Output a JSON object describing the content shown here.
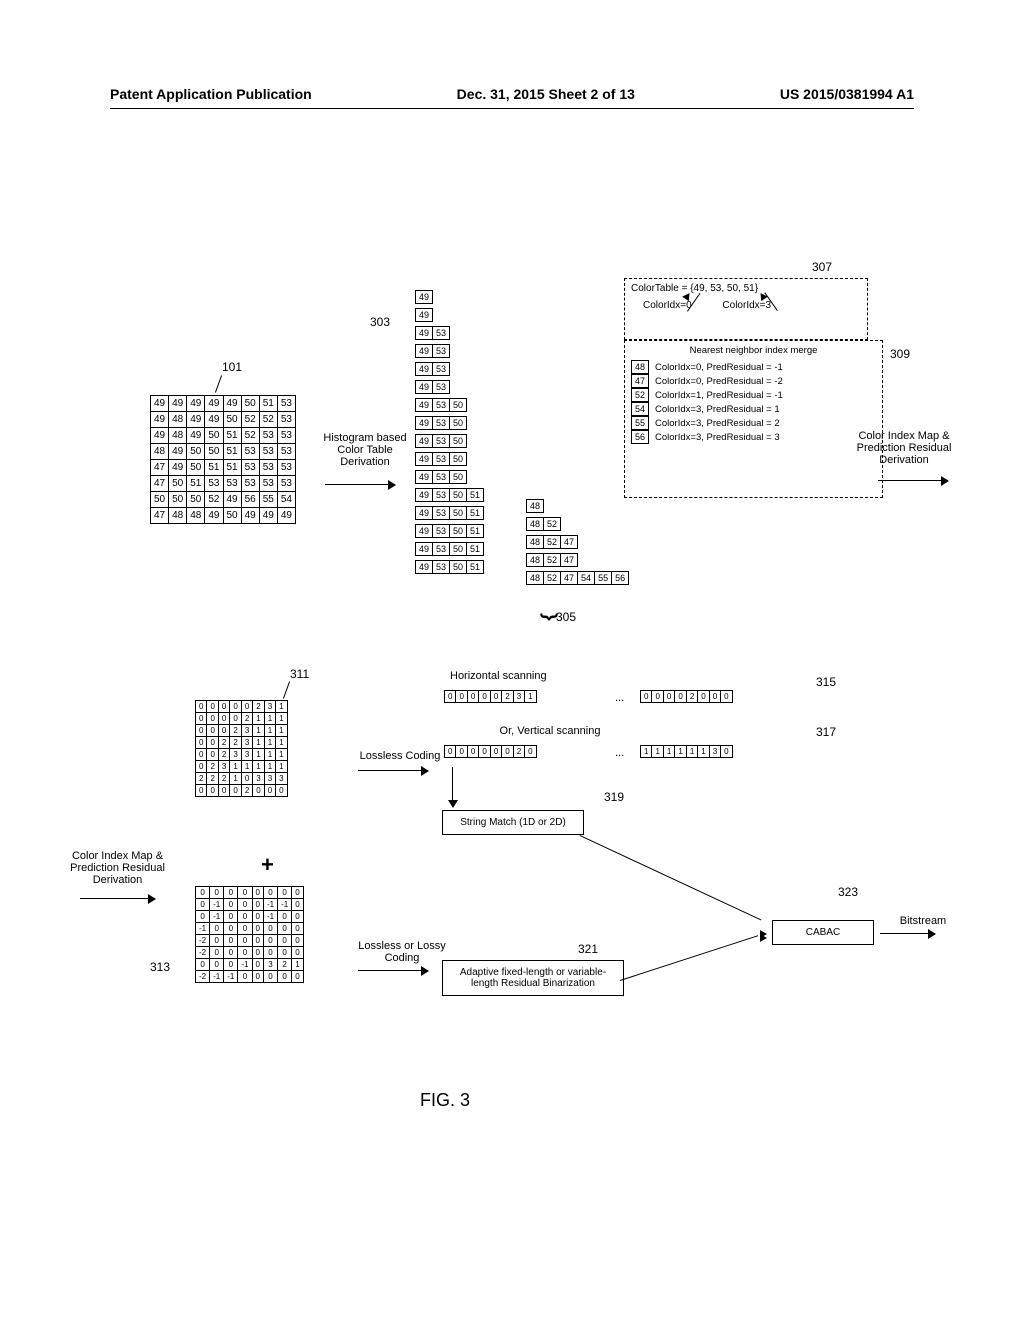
{
  "header": {
    "left": "Patent Application Publication",
    "mid": "Dec. 31, 2015  Sheet 2 of 13",
    "right": "US 2015/0381994 A1"
  },
  "callouts": {
    "c101": "101",
    "c303": "303",
    "c305": "305",
    "c307": "307",
    "c309": "309",
    "c311": "311",
    "c313": "313",
    "c315": "315",
    "c317": "317",
    "c319": "319",
    "c321": "321",
    "c323": "323"
  },
  "labels": {
    "hist": "Histogram based Color Table Derivation",
    "colorTable": "ColorTable = {49, 53, 50, 51}",
    "idx0": "ColorIdx=0",
    "idx3": "ColorIdx=3",
    "nn": "Nearest neighbor index merge",
    "r1": "ColorIdx=0, PredResidual = -1",
    "r2": "ColorIdx=0, PredResidual = -2",
    "r3": "ColorIdx=1, PredResidual = -1",
    "r4": "ColorIdx=3, PredResidual = 1",
    "r5": "ColorIdx=3, PredResidual = 2",
    "r6": "ColorIdx=3, PredResidual = 3",
    "cimap": "Color Index Map & Prediction Residual Derivation",
    "hscan": "Horizontal scanning",
    "orvscan": "Or, Vertical scanning",
    "lossless": "Lossless Coding",
    "losslossy": "Lossless or Lossy Coding",
    "stringmatch": "String Match (1D or 2D)",
    "adaptive": "Adaptive fixed-length or variable-length Residual Binarization",
    "cabac": "CABAC",
    "bitstream": "Bitstream",
    "cimap_in": "Color Index Map & Prediction Residual Derivation"
  },
  "values": {
    "v48": "48",
    "v47": "47",
    "v52": "52",
    "v54": "54",
    "v55": "55",
    "v56": "56"
  },
  "ellipsis": "...",
  "fig": "FIG. 3",
  "chart_data": {
    "type": "table",
    "block_101": [
      [
        49,
        49,
        49,
        49,
        49,
        50,
        51,
        53
      ],
      [
        49,
        48,
        49,
        49,
        50,
        52,
        52,
        53
      ],
      [
        49,
        48,
        49,
        50,
        51,
        52,
        53,
        53
      ],
      [
        48,
        49,
        50,
        50,
        51,
        53,
        53,
        53
      ],
      [
        47,
        49,
        50,
        51,
        51,
        53,
        53,
        53
      ],
      [
        47,
        50,
        51,
        53,
        53,
        53,
        53,
        53
      ],
      [
        50,
        50,
        50,
        52,
        49,
        56,
        55,
        54
      ],
      [
        47,
        48,
        48,
        49,
        50,
        49,
        49,
        49
      ]
    ],
    "histogram_303": [
      [
        49
      ],
      [
        49
      ],
      [
        49,
        53
      ],
      [
        49,
        53
      ],
      [
        49,
        53
      ],
      [
        49,
        53
      ],
      [
        49,
        53,
        50
      ],
      [
        49,
        53,
        50
      ],
      [
        49,
        53,
        50
      ],
      [
        49,
        53,
        50
      ],
      [
        49,
        53,
        50
      ],
      [
        49,
        53,
        50,
        51
      ],
      [
        49,
        53,
        50,
        51
      ],
      [
        49,
        53,
        50,
        51
      ],
      [
        49,
        53,
        50,
        51
      ],
      [
        49,
        53,
        50,
        51
      ]
    ],
    "histogram_tail_305": [
      [
        48
      ],
      [
        48,
        52
      ],
      [
        48,
        52,
        47
      ],
      [
        48,
        52,
        47
      ],
      [
        48,
        52,
        47,
        54,
        55,
        56
      ]
    ],
    "color_table": [
      49,
      53,
      50,
      51
    ],
    "nearest_merge_309": [
      {
        "src": 48,
        "idx": 0,
        "residual": -1
      },
      {
        "src": 47,
        "idx": 0,
        "residual": -2
      },
      {
        "src": 52,
        "idx": 1,
        "residual": -1
      },
      {
        "src": 54,
        "idx": 3,
        "residual": 1
      },
      {
        "src": 55,
        "idx": 3,
        "residual": 2
      },
      {
        "src": 56,
        "idx": 3,
        "residual": 3
      }
    ],
    "index_map_311": [
      [
        0,
        0,
        0,
        0,
        0,
        2,
        3,
        1
      ],
      [
        0,
        0,
        0,
        0,
        2,
        1,
        1,
        1
      ],
      [
        0,
        0,
        0,
        2,
        3,
        1,
        1,
        1
      ],
      [
        0,
        0,
        2,
        2,
        3,
        1,
        1,
        1
      ],
      [
        0,
        0,
        2,
        3,
        3,
        1,
        1,
        1
      ],
      [
        0,
        2,
        3,
        1,
        1,
        1,
        1,
        1
      ],
      [
        2,
        2,
        2,
        1,
        0,
        3,
        3,
        3
      ],
      [
        0,
        0,
        0,
        0,
        2,
        0,
        0,
        0
      ]
    ],
    "residual_map_313": [
      [
        0,
        0,
        0,
        0,
        0,
        0,
        0,
        0
      ],
      [
        0,
        -1,
        0,
        0,
        0,
        -1,
        -1,
        0
      ],
      [
        0,
        -1,
        0,
        0,
        0,
        -1,
        0,
        0
      ],
      [
        -1,
        0,
        0,
        0,
        0,
        0,
        0,
        0
      ],
      [
        -2,
        0,
        0,
        0,
        0,
        0,
        0,
        0
      ],
      [
        -2,
        0,
        0,
        0,
        0,
        0,
        0,
        0
      ],
      [
        0,
        0,
        0,
        -1,
        0,
        3,
        2,
        1
      ],
      [
        -2,
        -1,
        -1,
        0,
        0,
        0,
        0,
        0
      ]
    ],
    "hscan_315_front": [
      0,
      0,
      0,
      0,
      0,
      2,
      3,
      1
    ],
    "hscan_315_back": [
      0,
      0,
      0,
      0,
      2,
      0,
      0,
      0
    ],
    "vscan_317_front": [
      0,
      0,
      0,
      0,
      0,
      0,
      2,
      0
    ],
    "vscan_317_back": [
      1,
      1,
      1,
      1,
      1,
      1,
      3,
      0
    ]
  }
}
